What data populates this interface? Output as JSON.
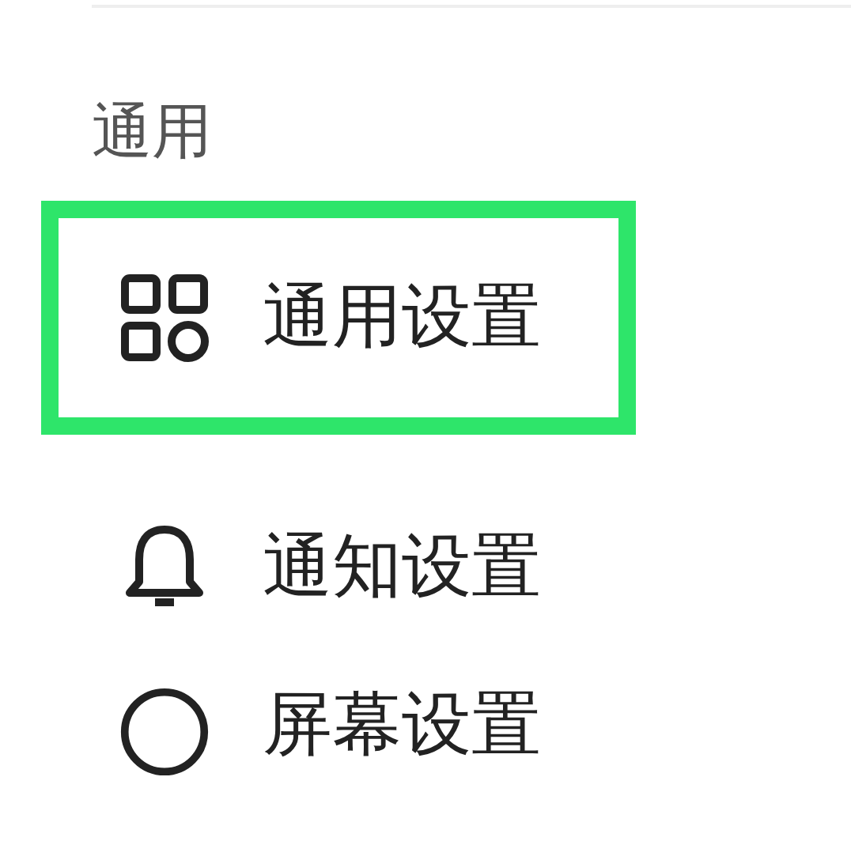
{
  "section": {
    "title": "通用"
  },
  "items": [
    {
      "label": "通用设置",
      "kind": "general",
      "highlighted": true
    },
    {
      "label": "通知设置",
      "kind": "notifications",
      "highlighted": false
    },
    {
      "label": "屏幕设置",
      "kind": "display",
      "highlighted": false
    }
  ]
}
